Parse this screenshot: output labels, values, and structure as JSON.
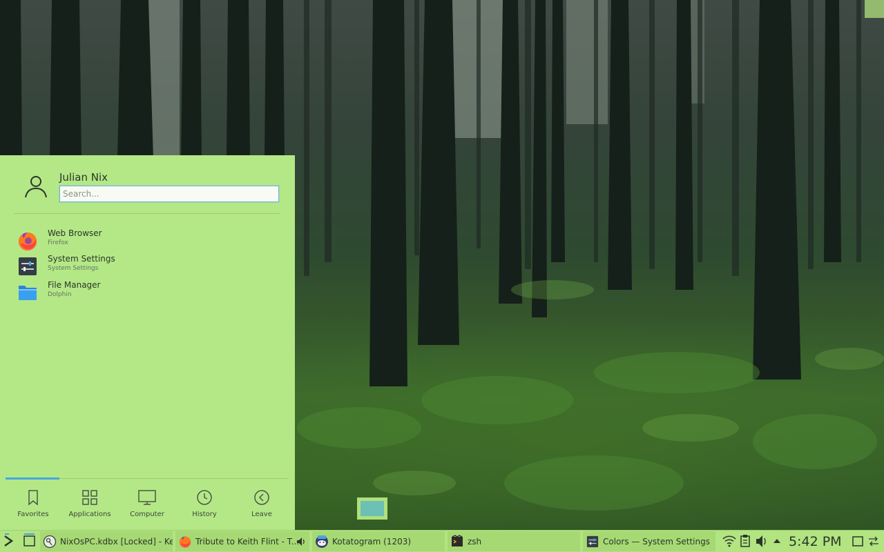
{
  "launcher": {
    "user_name": "Julian Nix",
    "search_placeholder": "Search...",
    "favorites": [
      {
        "title": "Web Browser",
        "subtitle": "Firefox",
        "icon": "firefox-icon"
      },
      {
        "title": "System Settings",
        "subtitle": "System Settings",
        "icon": "system-settings-icon"
      },
      {
        "title": "File Manager",
        "subtitle": "Dolphin",
        "icon": "folder-icon"
      }
    ],
    "tabs": [
      {
        "label": "Favorites",
        "icon": "bookmark-icon",
        "active": true
      },
      {
        "label": "Applications",
        "icon": "grid-icon",
        "active": false
      },
      {
        "label": "Computer",
        "icon": "monitor-icon",
        "active": false
      },
      {
        "label": "History",
        "icon": "clock-icon",
        "active": false
      },
      {
        "label": "Leave",
        "icon": "back-arrow-icon",
        "active": false
      }
    ]
  },
  "taskbar": {
    "tasks": [
      {
        "label": "NixOsPC.kdbx [Locked] - Ke...",
        "icon": "keepassxc-icon"
      },
      {
        "label": "Tribute to Keith Flint - T...",
        "icon": "firefox-icon",
        "extra_icon": "speaker-icon"
      },
      {
        "label": "Kotatogram (1203)",
        "icon": "kotatogram-icon",
        "badge": "1203"
      },
      {
        "label": "zsh",
        "icon": "terminal-icon"
      },
      {
        "label": "Colors  — System Settings",
        "icon": "system-settings-icon"
      }
    ],
    "tray_icons": [
      "wifi-icon",
      "clipboard-icon",
      "volume-icon",
      "expand-tray-icon"
    ],
    "clock": "5:42 PM"
  },
  "colors": {
    "launcher_bg": "#b4e887",
    "taskbar_bg": "#b2e482",
    "accent": "#4aa4de"
  }
}
